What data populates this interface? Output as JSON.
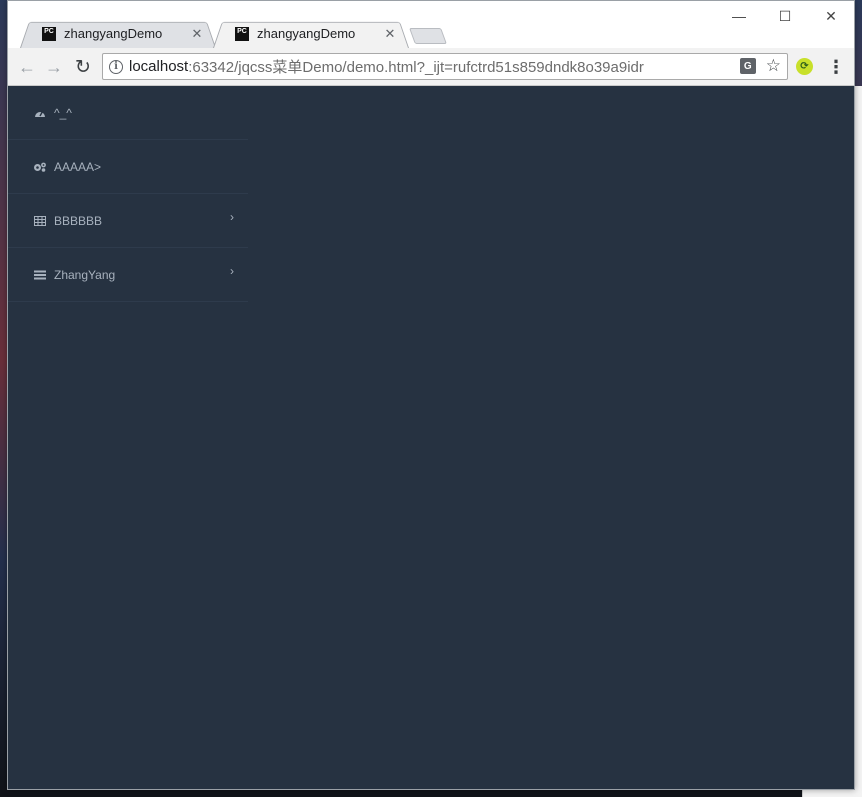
{
  "browser": {
    "tabs": [
      {
        "title": "zhangyangDemo",
        "favicon": "PC",
        "active": false
      },
      {
        "title": "zhangyangDemo",
        "favicon": "PC",
        "active": true
      }
    ],
    "url": {
      "host": "localhost",
      "rest": ":63342/jqcss菜单Demo/demo.html?_ijt=rufctrd51s859dndk8o39a9idr"
    },
    "controls": {
      "minimize": "—",
      "maximize": "☐",
      "close": "✕"
    }
  },
  "sidebar": {
    "items": [
      {
        "icon": "dashboard-icon",
        "label": "^_^",
        "has_arrow": false
      },
      {
        "icon": "cogs-icon",
        "label": "AAAAA>",
        "has_arrow": false
      },
      {
        "icon": "table-icon",
        "label": "BBBBBB",
        "has_arrow": true
      },
      {
        "icon": "list-icon",
        "label": "ZhangYang",
        "has_arrow": true
      }
    ]
  },
  "colors": {
    "page_bg": "#263241",
    "menu_text": "#a8b2be",
    "divider": "#2e3b4c"
  }
}
